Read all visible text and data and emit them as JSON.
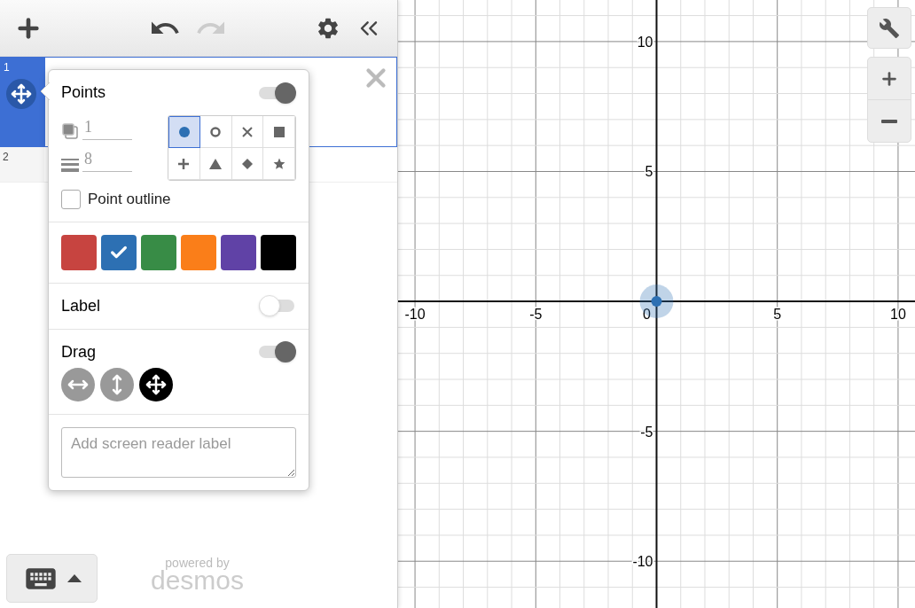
{
  "toolbar": {
    "undo": {
      "disabled": false
    },
    "redo": {
      "disabled": true
    }
  },
  "expressions": [
    {
      "number": "1",
      "selected": true
    },
    {
      "number": "2",
      "selected": false
    }
  ],
  "style_popup": {
    "title": "Points",
    "points_on": true,
    "opacity": "1",
    "thickness": "8",
    "shapes": [
      {
        "kind": "dot",
        "selected": true
      },
      {
        "kind": "open",
        "selected": false
      },
      {
        "kind": "cross",
        "selected": false
      },
      {
        "kind": "square",
        "selected": false
      },
      {
        "kind": "plus",
        "selected": false
      },
      {
        "kind": "triangle",
        "selected": false
      },
      {
        "kind": "diamond",
        "selected": false
      },
      {
        "kind": "star",
        "selected": false
      }
    ],
    "point_outline": {
      "label": "Point outline",
      "checked": false
    },
    "colors": [
      {
        "color": "#c74440",
        "selected": false
      },
      {
        "color": "#2d70b3",
        "selected": true
      },
      {
        "color": "#388c46",
        "selected": false
      },
      {
        "color": "#fa7e19",
        "selected": false
      },
      {
        "color": "#6042a6",
        "selected": false
      },
      {
        "color": "#000000",
        "selected": false
      }
    ],
    "label": {
      "text": "Label",
      "on": false
    },
    "drag": {
      "text": "Drag",
      "on": true,
      "modes": [
        {
          "kind": "horizontal",
          "selected": false
        },
        {
          "kind": "vertical",
          "selected": false
        },
        {
          "kind": "both",
          "selected": true
        }
      ]
    },
    "screen_reader": {
      "placeholder": "Add screen reader label"
    }
  },
  "footer": {
    "powered_by": "powered by",
    "brand": "desmos"
  },
  "graph": {
    "origin_label": "0",
    "chart_data": {
      "type": "scatter",
      "x": [
        0
      ],
      "series": [
        {
          "color": "#2d70b3",
          "values": [
            0
          ]
        }
      ],
      "xlim": [
        -10.7,
        10.7
      ],
      "ylim": [
        -11.8,
        11.6
      ],
      "xticks": [
        -10,
        -5,
        5,
        10
      ],
      "yticks": [
        -10,
        -5,
        5,
        10
      ],
      "grid": true
    }
  }
}
